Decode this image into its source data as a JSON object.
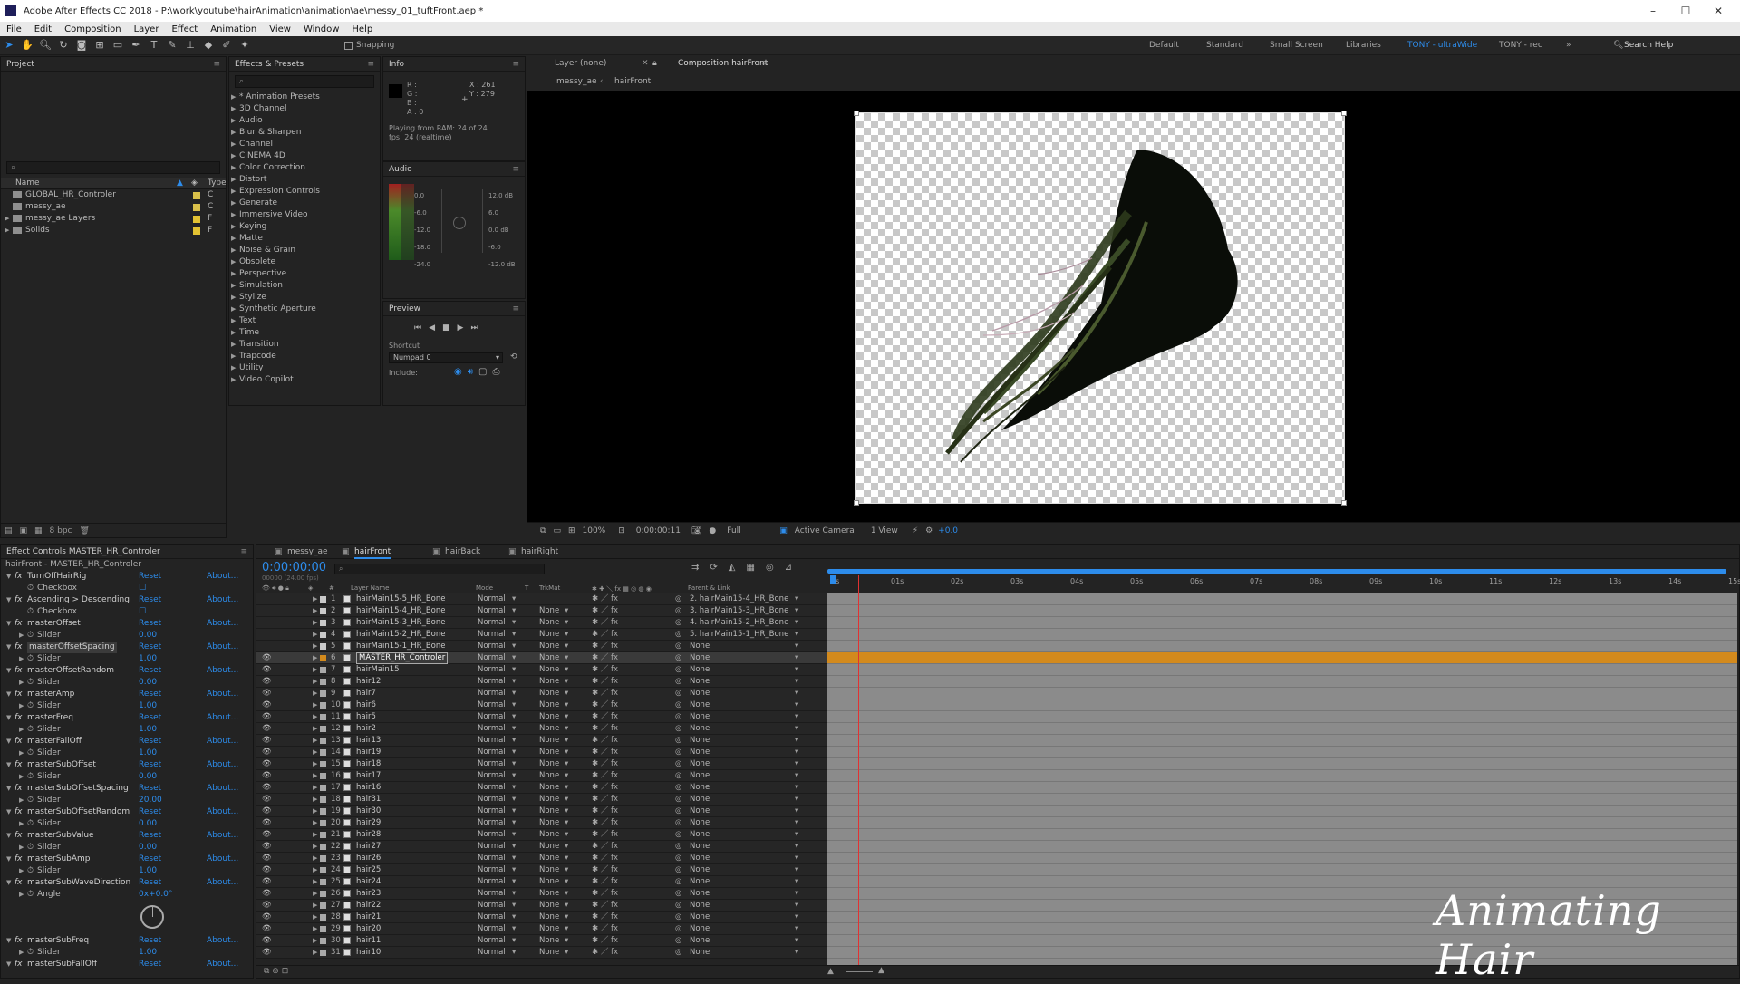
{
  "window": {
    "title": "Adobe After Effects CC 2018 - P:\\work\\youtube\\hairAnimation\\animation\\ae\\messy_01_tuftFront.aep *"
  },
  "menu": [
    "File",
    "Edit",
    "Composition",
    "Layer",
    "Effect",
    "Animation",
    "View",
    "Window",
    "Help"
  ],
  "toolbar": {
    "snapping": "Snapping",
    "search": "Search Help"
  },
  "workspaces": [
    "Default",
    "Standard",
    "Small Screen",
    "Libraries",
    "TONY - ultraWide",
    "TONY - rec"
  ],
  "project": {
    "title": "Project",
    "col_name": "Name",
    "col_type": "Type",
    "items": [
      {
        "name": "GLOBAL_HR_Controler",
        "color": "#d9c04a",
        "type": "C"
      },
      {
        "name": "messy_ae",
        "color": "#d9c04a",
        "type": "C"
      },
      {
        "name": "messy_ae Layers",
        "color": "#e2c232",
        "type": "F"
      },
      {
        "name": "Solids",
        "color": "#e2c232",
        "type": "F"
      }
    ],
    "bpc": "8 bpc"
  },
  "effects_presets": {
    "title": "Effects & Presets",
    "items": [
      "* Animation Presets",
      "3D Channel",
      "Audio",
      "Blur & Sharpen",
      "Channel",
      "CINEMA 4D",
      "Color Correction",
      "Distort",
      "Expression Controls",
      "Generate",
      "Immersive Video",
      "Keying",
      "Matte",
      "Noise & Grain",
      "Obsolete",
      "Perspective",
      "Simulation",
      "Stylize",
      "Synthetic Aperture",
      "Text",
      "Time",
      "Transition",
      "Trapcode",
      "Utility",
      "Video Copilot"
    ]
  },
  "info": {
    "title": "Info",
    "channels": [
      "R :",
      "G :",
      "B :",
      "A : 0"
    ],
    "x": "X : 261",
    "y": "Y : 279",
    "status1": "Playing from RAM: 24 of 24",
    "status2": "fps: 24 (realtime)"
  },
  "audio": {
    "title": "Audio",
    "left_scale": [
      "0.0",
      "-6.0",
      "-12.0",
      "-18.0",
      "-24.0"
    ],
    "right_scale": [
      "12.0 dB",
      "6.0",
      "0.0 dB",
      "-6.0",
      "-12.0 dB"
    ]
  },
  "preview": {
    "title": "Preview",
    "shortcut_label": "Shortcut",
    "shortcut_value": "Numpad 0",
    "include_label": "Include:"
  },
  "viewer": {
    "layer_tab": "Layer (none)",
    "comp_tab": "Composition hairFront",
    "breadcrumb": [
      "messy_ae",
      "hairFront"
    ],
    "zoom": "100%",
    "timecode": "0:00:00:11",
    "resolution": "Full",
    "camera": "Active Camera",
    "views": "1 View",
    "exposure": "+0.0"
  },
  "effect_controls": {
    "title": "Effect Controls MASTER_HR_Controler",
    "subtitle": "hairFront - MASTER_HR_Controler",
    "rows": [
      {
        "kind": "fx",
        "name": "TurnOffHairRig",
        "reset": "Reset",
        "about": "About..."
      },
      {
        "kind": "prop",
        "name": "Checkbox",
        "value": "☐"
      },
      {
        "kind": "fx",
        "name": "Ascending > Descending",
        "reset": "Reset",
        "about": "About..."
      },
      {
        "kind": "prop",
        "name": "Checkbox",
        "value": "☐"
      },
      {
        "kind": "fx",
        "name": "masterOffset",
        "reset": "Reset",
        "about": "About..."
      },
      {
        "kind": "prop",
        "name": "Slider",
        "value": "0.00"
      },
      {
        "kind": "fx",
        "name": "masterOffsetSpacing",
        "reset": "Reset",
        "about": "About..."
      },
      {
        "kind": "prop",
        "name": "Slider",
        "value": "1.00"
      },
      {
        "kind": "fx",
        "name": "masterOffsetRandom",
        "reset": "Reset",
        "about": "About..."
      },
      {
        "kind": "prop",
        "name": "Slider",
        "value": "0.00"
      },
      {
        "kind": "fx",
        "name": "masterAmp",
        "reset": "Reset",
        "about": "About..."
      },
      {
        "kind": "prop",
        "name": "Slider",
        "value": "1.00"
      },
      {
        "kind": "fx",
        "name": "masterFreq",
        "reset": "Reset",
        "about": "About..."
      },
      {
        "kind": "prop",
        "name": "Slider",
        "value": "1.00"
      },
      {
        "kind": "fx",
        "name": "masterFallOff",
        "reset": "Reset",
        "about": "About..."
      },
      {
        "kind": "prop",
        "name": "Slider",
        "value": "1.00"
      },
      {
        "kind": "fx",
        "name": "masterSubOffset",
        "reset": "Reset",
        "about": "About..."
      },
      {
        "kind": "prop",
        "name": "Slider",
        "value": "0.00"
      },
      {
        "kind": "fx",
        "name": "masterSubOffsetSpacing",
        "reset": "Reset",
        "about": "About..."
      },
      {
        "kind": "prop",
        "name": "Slider",
        "value": "20.00"
      },
      {
        "kind": "fx",
        "name": "masterSubOffsetRandom",
        "reset": "Reset",
        "about": "About..."
      },
      {
        "kind": "prop",
        "name": "Slider",
        "value": "0.00"
      },
      {
        "kind": "fx",
        "name": "masterSubValue",
        "reset": "Reset",
        "about": "About..."
      },
      {
        "kind": "prop",
        "name": "Slider",
        "value": "0.00"
      },
      {
        "kind": "fx",
        "name": "masterSubAmp",
        "reset": "Reset",
        "about": "About..."
      },
      {
        "kind": "prop",
        "name": "Slider",
        "value": "1.00"
      },
      {
        "kind": "fx",
        "name": "masterSubWaveDirection",
        "reset": "Reset",
        "about": "About..."
      },
      {
        "kind": "prop",
        "name": "Angle",
        "value": "0x+0.0°"
      },
      {
        "kind": "dial"
      },
      {
        "kind": "fx",
        "name": "masterSubFreq",
        "reset": "Reset",
        "about": "About..."
      },
      {
        "kind": "prop",
        "name": "Slider",
        "value": "1.00"
      },
      {
        "kind": "fx",
        "name": "masterSubFallOff",
        "reset": "Reset",
        "about": "About..."
      }
    ]
  },
  "timeline": {
    "tabs": [
      "messy_ae",
      "hairFront",
      "hairBack",
      "hairRight"
    ],
    "active_tab": "hairFront",
    "timecode": "0:00:00:00",
    "fps_note": "00000 (24.00 fps)",
    "col_headers": {
      "num": "#",
      "name": "Layer Name",
      "mode": "Mode",
      "t": "T",
      "trkmat": "TrkMat",
      "parent": "Parent & Link"
    },
    "ruler": [
      "0s",
      "01s",
      "02s",
      "03s",
      "04s",
      "05s",
      "06s",
      "07s",
      "08s",
      "09s",
      "10s",
      "11s",
      "12s",
      "13s",
      "14s",
      "15s"
    ],
    "layers": [
      {
        "n": "1",
        "name": "hairMain15-5_HR_Bone",
        "mode": "Normal",
        "trk": "",
        "parent": "2. hairMain15-4_HR_Bone",
        "eye": false,
        "color": "#c9c9c9"
      },
      {
        "n": "2",
        "name": "hairMain15-4_HR_Bone",
        "mode": "Normal",
        "trk": "None",
        "parent": "3. hairMain15-3_HR_Bone",
        "eye": false,
        "color": "#c9c9c9"
      },
      {
        "n": "3",
        "name": "hairMain15-3_HR_Bone",
        "mode": "Normal",
        "trk": "None",
        "parent": "4. hairMain15-2_HR_Bone",
        "eye": false,
        "color": "#c9c9c9"
      },
      {
        "n": "4",
        "name": "hairMain15-2_HR_Bone",
        "mode": "Normal",
        "trk": "None",
        "parent": "5. hairMain15-1_HR_Bone",
        "eye": false,
        "color": "#c9c9c9"
      },
      {
        "n": "5",
        "name": "hairMain15-1_HR_Bone",
        "mode": "Normal",
        "trk": "None",
        "parent": "None",
        "eye": false,
        "color": "#c9c9c9"
      },
      {
        "n": "6",
        "name": "MASTER_HR_Controler",
        "mode": "Normal",
        "trk": "None",
        "parent": "None",
        "eye": true,
        "color": "#d38a1d",
        "selected": true
      },
      {
        "n": "7",
        "name": "hairMain15",
        "mode": "Normal",
        "trk": "None",
        "parent": "None",
        "eye": true,
        "color": "#a9a9a9"
      },
      {
        "n": "8",
        "name": "hair12",
        "mode": "Normal",
        "trk": "None",
        "parent": "None",
        "eye": true,
        "color": "#a9a9a9"
      },
      {
        "n": "9",
        "name": "hair7",
        "mode": "Normal",
        "trk": "None",
        "parent": "None",
        "eye": true,
        "color": "#a9a9a9"
      },
      {
        "n": "10",
        "name": "hair6",
        "mode": "Normal",
        "trk": "None",
        "parent": "None",
        "eye": true,
        "color": "#a9a9a9"
      },
      {
        "n": "11",
        "name": "hair5",
        "mode": "Normal",
        "trk": "None",
        "parent": "None",
        "eye": true,
        "color": "#a9a9a9"
      },
      {
        "n": "12",
        "name": "hair2",
        "mode": "Normal",
        "trk": "None",
        "parent": "None",
        "eye": true,
        "color": "#a9a9a9"
      },
      {
        "n": "13",
        "name": "hair13",
        "mode": "Normal",
        "trk": "None",
        "parent": "None",
        "eye": true,
        "color": "#a9a9a9"
      },
      {
        "n": "14",
        "name": "hair19",
        "mode": "Normal",
        "trk": "None",
        "parent": "None",
        "eye": true,
        "color": "#a9a9a9"
      },
      {
        "n": "15",
        "name": "hair18",
        "mode": "Normal",
        "trk": "None",
        "parent": "None",
        "eye": true,
        "color": "#a9a9a9"
      },
      {
        "n": "16",
        "name": "hair17",
        "mode": "Normal",
        "trk": "None",
        "parent": "None",
        "eye": true,
        "color": "#a9a9a9"
      },
      {
        "n": "17",
        "name": "hair16",
        "mode": "Normal",
        "trk": "None",
        "parent": "None",
        "eye": true,
        "color": "#a9a9a9"
      },
      {
        "n": "18",
        "name": "hair31",
        "mode": "Normal",
        "trk": "None",
        "parent": "None",
        "eye": true,
        "color": "#a9a9a9"
      },
      {
        "n": "19",
        "name": "hair30",
        "mode": "Normal",
        "trk": "None",
        "parent": "None",
        "eye": true,
        "color": "#a9a9a9"
      },
      {
        "n": "20",
        "name": "hair29",
        "mode": "Normal",
        "trk": "None",
        "parent": "None",
        "eye": true,
        "color": "#a9a9a9"
      },
      {
        "n": "21",
        "name": "hair28",
        "mode": "Normal",
        "trk": "None",
        "parent": "None",
        "eye": true,
        "color": "#a9a9a9"
      },
      {
        "n": "22",
        "name": "hair27",
        "mode": "Normal",
        "trk": "None",
        "parent": "None",
        "eye": true,
        "color": "#a9a9a9"
      },
      {
        "n": "23",
        "name": "hair26",
        "mode": "Normal",
        "trk": "None",
        "parent": "None",
        "eye": true,
        "color": "#a9a9a9"
      },
      {
        "n": "24",
        "name": "hair25",
        "mode": "Normal",
        "trk": "None",
        "parent": "None",
        "eye": true,
        "color": "#a9a9a9"
      },
      {
        "n": "25",
        "name": "hair24",
        "mode": "Normal",
        "trk": "None",
        "parent": "None",
        "eye": true,
        "color": "#a9a9a9"
      },
      {
        "n": "26",
        "name": "hair23",
        "mode": "Normal",
        "trk": "None",
        "parent": "None",
        "eye": true,
        "color": "#a9a9a9"
      },
      {
        "n": "27",
        "name": "hair22",
        "mode": "Normal",
        "trk": "None",
        "parent": "None",
        "eye": true,
        "color": "#a9a9a9"
      },
      {
        "n": "28",
        "name": "hair21",
        "mode": "Normal",
        "trk": "None",
        "parent": "None",
        "eye": true,
        "color": "#a9a9a9"
      },
      {
        "n": "29",
        "name": "hair20",
        "mode": "Normal",
        "trk": "None",
        "parent": "None",
        "eye": true,
        "color": "#a9a9a9"
      },
      {
        "n": "30",
        "name": "hair11",
        "mode": "Normal",
        "trk": "None",
        "parent": "None",
        "eye": true,
        "color": "#a9a9a9"
      },
      {
        "n": "31",
        "name": "hair10",
        "mode": "Normal",
        "trk": "None",
        "parent": "None",
        "eye": true,
        "color": "#a9a9a9"
      }
    ]
  },
  "watermark": "Animating Hair",
  "colors": {
    "accent": "#2d8ceb",
    "selected_layer": "#d38a1d",
    "playhead": "#e03232"
  }
}
